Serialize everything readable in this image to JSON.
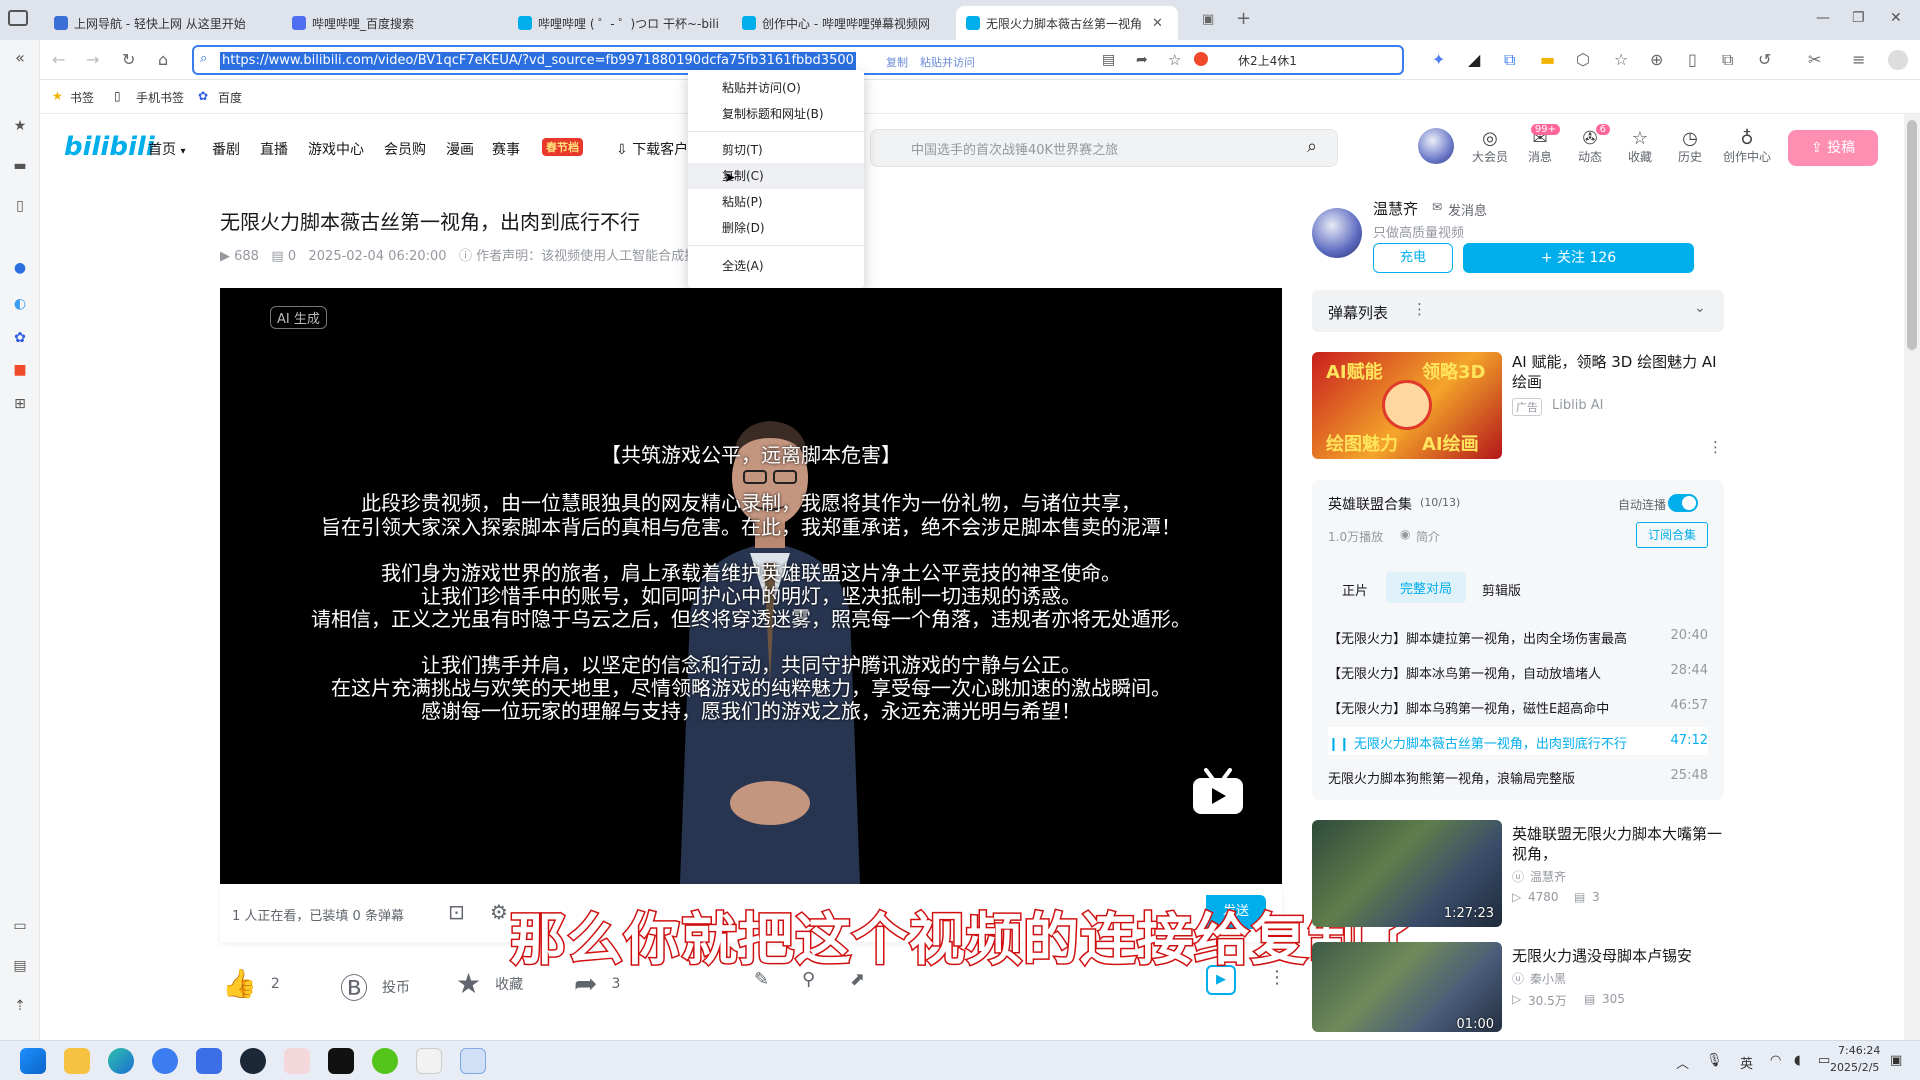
{
  "browser": {
    "tabs": [
      {
        "label": "上网导航 - 轻快上网 从这里开始",
        "color": "#3b6fd8"
      },
      {
        "label": "哔哩哔哩_百度搜索",
        "color": "#4e6ef2"
      },
      {
        "label": "哔哩哔哩 ( ゜- ゜)つロ 干杯~-bili",
        "color": "#00aeec"
      },
      {
        "label": "创作中心 - 哔哩哔哩弹幕视频网",
        "color": "#00aeec"
      },
      {
        "label": "无限火力脚本薇古丝第一视角",
        "color": "#00aeec"
      }
    ],
    "url": "https://www.bilibili.com/video/BV1qcF7eKEUA/?vd_source=fb9971880190dcfa75fb3161fbbd3500",
    "url_copy": "复制",
    "url_paste_visit": "粘贴并访问",
    "search_engine_text": "休2上4休1",
    "bookmarks": [
      "书签",
      "手机书签",
      "百度"
    ]
  },
  "context_menu": {
    "items": [
      "粘贴并访问(O)",
      "复制标题和网址(B)",
      "剪切(T)",
      "复制(C)",
      "粘贴(P)",
      "删除(D)",
      "全选(A)"
    ],
    "highlighted": "复制(C)"
  },
  "bili_header": {
    "logo": "bilibili",
    "nav": [
      "首页",
      "番剧",
      "直播",
      "游戏中心",
      "会员购",
      "漫画",
      "赛事",
      "春节档",
      "下载客户端"
    ],
    "search_placeholder": "中国选手的首次战锤40K世界赛之旅",
    "icons": [
      {
        "label": "大会员",
        "badge": ""
      },
      {
        "label": "消息",
        "badge": "99+"
      },
      {
        "label": "动态",
        "badge": "6"
      },
      {
        "label": "收藏",
        "badge": ""
      },
      {
        "label": "历史",
        "badge": ""
      },
      {
        "label": "创作中心",
        "badge": ""
      }
    ],
    "upload": "投稿",
    "accent": "#00aeec",
    "pink": "#ff6699"
  },
  "video": {
    "title": "无限火力脚本薇古丝第一视角，出肉到底行不行",
    "views": "688",
    "danmaku": "0",
    "date": "2025-02-04 06:20:00",
    "notice": "作者声明：该视频使用人工智能合成技术，请谨慎甄别",
    "ai_tag": "AI 生成",
    "screen_text": [
      "【共筑游戏公平，远离脚本危害】",
      "此段珍贵视频，由一位慧眼独具的网友精心录制，我愿将其作为一份礼物，与诸位共享，",
      "旨在引领大家深入探索脚本背后的真相与危害。在此，我郑重承诺，绝不会涉足脚本售卖的泥潭！",
      "我们身为游戏世界的旅者，肩上承载着维护英雄联盟这片净土公平竞技的神圣使命。",
      "让我们珍惜手中的账号，如同呵护心中的明灯，坚决抵制一切违规的诱惑。",
      "请相信，正义之光虽有时隐于乌云之后，但终将穿透迷雾，照亮每一个角落，违规者亦将无处遁形。",
      "让我们携手并肩，以坚定的信念和行动，共同守护腾讯游戏的宁静与公正。",
      "在这片充满挑战与欢笑的天地里，尽情领略游戏的纯粹魅力，享受每一次心跳加速的激战瞬间。",
      "感谢每一位玩家的理解与支持，愿我们的游戏之旅，永远充满光明与希望！"
    ],
    "watching": "1 人正在看，已装填 0 条弹幕",
    "send": "发送",
    "actions": {
      "like": "2",
      "coin": "投币",
      "fav": "收藏",
      "share": "3"
    },
    "subtitle": "那么你就把这个视频的连接给复制了"
  },
  "uploader": {
    "name": "温慧齐",
    "message": "发消息",
    "desc": "只做高质量视频",
    "charge": "充电",
    "follow": "+ 关注 126"
  },
  "danmaku_list": {
    "label": "弹幕列表"
  },
  "ad": {
    "title": "AI 赋能，领略 3D 绘图魅力 AI绘画",
    "tag": "广告",
    "source": "Liblib AI",
    "thumb_text": [
      "AI赋能",
      "领略3D",
      "绘图魅力",
      "AI绘画"
    ]
  },
  "collection": {
    "title": "英雄联盟合集",
    "progress": "(10/13)",
    "autoplay": "自动连播",
    "plays": "1.0万播放",
    "intro": "简介",
    "subscribe": "订阅合集",
    "tabs": [
      "正片",
      "完整对局",
      "剪辑版"
    ],
    "active_tab": "完整对局",
    "items": [
      {
        "title": "【无限火力】脚本婕拉第一视角，出肉全场伤害最高",
        "dur": "20:40",
        "current": false
      },
      {
        "title": "【无限火力】脚本冰鸟第一视角，自动放墙堵人",
        "dur": "28:44",
        "current": false
      },
      {
        "title": "【无限火力】脚本乌鸦第一视角，磁性E超高命中",
        "dur": "46:57",
        "current": false
      },
      {
        "title": "无限火力脚本薇古丝第一视角，出肉到底行不行",
        "dur": "47:12",
        "current": true
      },
      {
        "title": "无限火力脚本狗熊第一视角，浪输局完整版",
        "dur": "25:48",
        "current": false
      }
    ]
  },
  "recommendations": [
    {
      "title": "英雄联盟无限火力脚本大嘴第一视角，",
      "up": "温慧齐",
      "views": "4780",
      "comments": "3",
      "dur": "1:27:23"
    },
    {
      "title": "无限火力遇没母脚本卢锡安",
      "up": "秦小黑",
      "views": "30.5万",
      "comments": "305",
      "dur": "01:00"
    }
  ],
  "taskbar": {
    "ime": "英",
    "time": "7:46:24",
    "date": "2025/2/5"
  }
}
